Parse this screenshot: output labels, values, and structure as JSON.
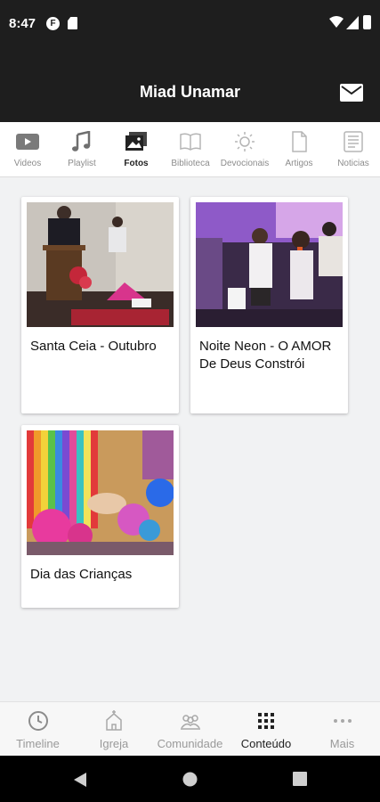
{
  "status_bar": {
    "time": "8:47",
    "icons": [
      "f-app-icon",
      "sd-card-icon",
      "wifi-icon",
      "signal-icon",
      "battery-icon"
    ]
  },
  "app_bar": {
    "title": "Miad Unamar",
    "action_icon": "mail-icon"
  },
  "tabs": [
    {
      "label": "Videos",
      "icon": "video-icon",
      "active": false
    },
    {
      "label": "Playlist",
      "icon": "music-note-icon",
      "active": false
    },
    {
      "label": "Fotos",
      "icon": "photos-icon",
      "active": true
    },
    {
      "label": "Biblioteca",
      "icon": "book-icon",
      "active": false
    },
    {
      "label": "Devocionais",
      "icon": "sun-icon",
      "active": false
    },
    {
      "label": "Artigos",
      "icon": "document-icon",
      "active": false
    },
    {
      "label": "Noticias",
      "icon": "newspaper-icon",
      "active": false
    }
  ],
  "albums": [
    {
      "title": "Santa Ceia - Outubro"
    },
    {
      "title": "Noite Neon - O AMOR De Deus Constrói"
    },
    {
      "title": "Dia das Crianças"
    }
  ],
  "bottom_nav": [
    {
      "label": "Timeline",
      "icon": "clock-icon",
      "active": false
    },
    {
      "label": "Igreja",
      "icon": "church-icon",
      "active": false
    },
    {
      "label": "Comunidade",
      "icon": "community-icon",
      "active": false
    },
    {
      "label": "Conteúdo",
      "icon": "grid-icon",
      "active": true
    },
    {
      "label": "Mais",
      "icon": "more-dots-icon",
      "active": false
    }
  ],
  "colors": {
    "bar_background": "#1e1e1e",
    "page_background": "#f1f2f3",
    "active_text": "#222222",
    "inactive_text": "#8c8c8c"
  }
}
